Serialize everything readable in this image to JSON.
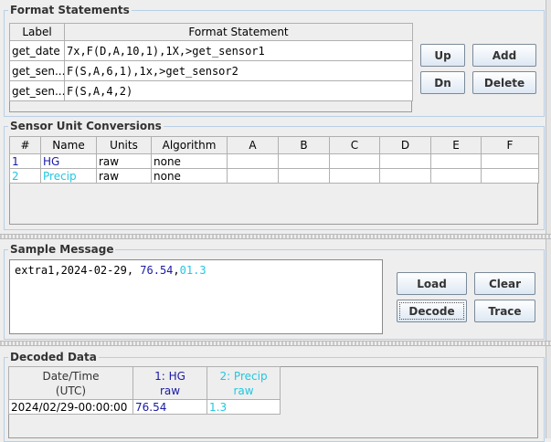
{
  "format_statements": {
    "title": "Format Statements",
    "headers": {
      "label": "Label",
      "statement": "Format Statement"
    },
    "rows": [
      {
        "label": "get_date",
        "statement": "7x,F(D,A,10,1),1X,>get_sensor1"
      },
      {
        "label": "get_sen...",
        "statement": "F(S,A,6,1),1x,>get_sensor2"
      },
      {
        "label": "get_sen...",
        "statement": "F(S,A,4,2)"
      }
    ],
    "buttons": {
      "up": "Up",
      "add": "Add",
      "dn": "Dn",
      "delete": "Delete"
    }
  },
  "sensor_conversions": {
    "title": "Sensor Unit Conversions",
    "headers": [
      "#",
      "Name",
      "Units",
      "Algorithm",
      "A",
      "B",
      "C",
      "D",
      "E",
      "F"
    ],
    "rows": [
      {
        "num": "1",
        "name": "HG",
        "units": "raw",
        "algorithm": "none",
        "color": "#1a1aa6"
      },
      {
        "num": "2",
        "name": "Precip",
        "units": "raw",
        "algorithm": "none",
        "color": "#20c8e0"
      }
    ]
  },
  "sample_message": {
    "title": "Sample Message",
    "segments": [
      {
        "text": "extra1,2024-02-29, ",
        "color": "#000000"
      },
      {
        "text": "76.54",
        "color": "#1a1aa6"
      },
      {
        "text": ",",
        "color": "#000000"
      },
      {
        "text": "01.3",
        "color": "#20c8e0"
      }
    ],
    "buttons": {
      "load": "Load",
      "clear": "Clear",
      "decode": "Decode",
      "trace": "Trace"
    }
  },
  "decoded_data": {
    "title": "Decoded Data",
    "headers": [
      {
        "line1": "Date/Time",
        "line2": "(UTC)",
        "color": "#333333"
      },
      {
        "line1": "1: HG",
        "line2": "raw",
        "color": "#1a1aa6"
      },
      {
        "line1": "2: Precip",
        "line2": "raw",
        "color": "#20c8e0"
      }
    ],
    "rows": [
      {
        "datetime": "2024/02/29-00:00:00",
        "hg": "76.54",
        "precip": "1.3"
      }
    ]
  }
}
